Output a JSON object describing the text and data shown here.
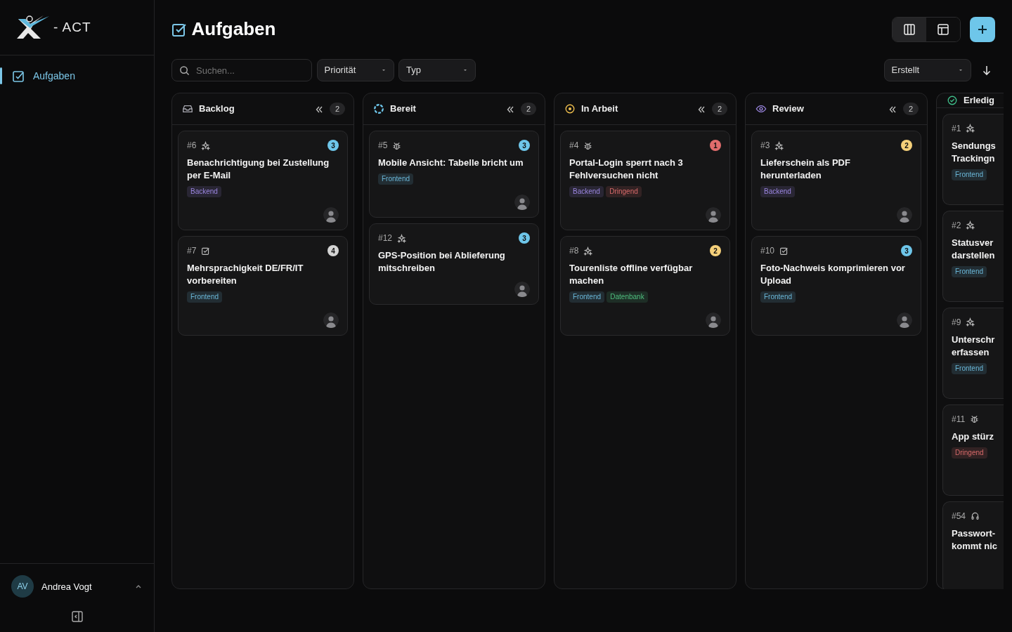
{
  "sidebar": {
    "logo": {
      "text": "- ACT"
    },
    "items": [
      {
        "label": "Aufgaben",
        "selected": true
      }
    ],
    "user": {
      "initials": "AV",
      "name": "Andrea Vogt"
    }
  },
  "header": {
    "title": "Aufgaben",
    "views": [
      {
        "kind": "board",
        "selected": true
      },
      {
        "kind": "table",
        "selected": false
      }
    ]
  },
  "filters": {
    "search": {
      "placeholder": "Suchen..."
    },
    "selects": [
      "Priorität",
      "Typ"
    ],
    "sort": "Erstellt"
  },
  "columns": [
    {
      "kind": "backlog",
      "color": "#a8a8b0",
      "title": "Backlog",
      "count": "2",
      "cut": false,
      "cards": [
        {
          "id": "#6",
          "kind": "feature",
          "priority": "3",
          "color": "#6ec6ea",
          "title": "Benachrichtigung bei Zustellung per E-Mail",
          "tags": [
            {
              "label": "Backend",
              "color": "#9b86e0"
            }
          ],
          "avatar": {
            "kind": "picture"
          }
        },
        {
          "id": "#7",
          "kind": "task",
          "priority": "4",
          "color": "#d4d4d4",
          "title": "Mehrsprachigkeit DE/FR/IT vorbereiten",
          "tags": [
            {
              "label": "Frontend",
              "color": "#6ab7d8"
            }
          ],
          "avatar": {
            "kind": "picture"
          }
        }
      ]
    },
    {
      "kind": "ready",
      "color": "#6ec6ea",
      "title": "Bereit",
      "count": "2",
      "cut": false,
      "cards": [
        {
          "id": "#5",
          "kind": "bug",
          "priority": "3",
          "color": "#6ec6ea",
          "title": "Mobile Ansicht: Tabelle bricht um",
          "tags": [
            {
              "label": "Frontend",
              "color": "#6ab7d8"
            }
          ],
          "avatar": {
            "kind": "picture"
          }
        },
        {
          "id": "#12",
          "kind": "feature",
          "priority": "3",
          "color": "#6ec6ea",
          "title": "GPS-Position bei Ablieferung mitschreiben",
          "avatar": {
            "kind": "picture"
          }
        }
      ]
    },
    {
      "kind": "progress",
      "color": "#f2c14e",
      "title": "In Arbeit",
      "count": "2",
      "cut": false,
      "cards": [
        {
          "id": "#4",
          "kind": "bug",
          "priority": "1",
          "color": "#e06c6c",
          "title": "Portal-Login sperrt nach 3 Fehlversuchen nicht",
          "tags": [
            {
              "label": "Backend",
              "color": "#9b86e0"
            },
            {
              "label": "Dringend",
              "color": "#d86a6a"
            }
          ],
          "avatar": {
            "kind": "picture"
          }
        },
        {
          "id": "#8",
          "kind": "feature",
          "priority": "2",
          "color": "#f5d07a",
          "title": "Tourenliste offline verfügbar machen",
          "tags": [
            {
              "label": "Frontend",
              "color": "#6ab7d8"
            },
            {
              "label": "Datenbank",
              "color": "#4fbf7f"
            }
          ],
          "avatar": {
            "kind": "picture"
          }
        }
      ]
    },
    {
      "kind": "review",
      "color": "#9b86e0",
      "title": "Review",
      "count": "2",
      "cut": false,
      "cards": [
        {
          "id": "#3",
          "kind": "feature",
          "priority": "2",
          "color": "#f5d07a",
          "title": "Lieferschein als PDF herunterladen",
          "tags": [
            {
              "label": "Backend",
              "color": "#9b86e0"
            }
          ],
          "avatar": {
            "kind": "picture"
          }
        },
        {
          "id": "#10",
          "kind": "task",
          "priority": "3",
          "color": "#6ec6ea",
          "title": "Foto-Nachweis komprimieren vor Upload",
          "tags": [
            {
              "label": "Frontend",
              "color": "#6ab7d8"
            }
          ],
          "avatar": {
            "kind": "picture"
          }
        }
      ]
    },
    {
      "kind": "done",
      "color": "#3fbf8a",
      "title": "Erledig",
      "cut": true,
      "cards": [
        {
          "id": "#1",
          "kind": "feature",
          "title": "Sendungs\nTrackingn",
          "tags": [
            {
              "label": "Frontend",
              "color": "#6ab7d8"
            }
          ]
        },
        {
          "id": "#2",
          "kind": "feature",
          "title": "Statusver\ndarstellen",
          "tags": [
            {
              "label": "Frontend",
              "color": "#6ab7d8"
            }
          ]
        },
        {
          "id": "#9",
          "kind": "feature",
          "title": "Unterschr\nerfassen",
          "tags": [
            {
              "label": "Frontend",
              "color": "#6ab7d8"
            }
          ]
        },
        {
          "id": "#11",
          "kind": "bug",
          "title": "App stürz",
          "tags": [
            {
              "label": "Dringend",
              "color": "#d86a6a"
            }
          ]
        },
        {
          "id": "#54",
          "kind": "support",
          "title": "Passwort-\nkommt nic"
        }
      ]
    }
  ]
}
